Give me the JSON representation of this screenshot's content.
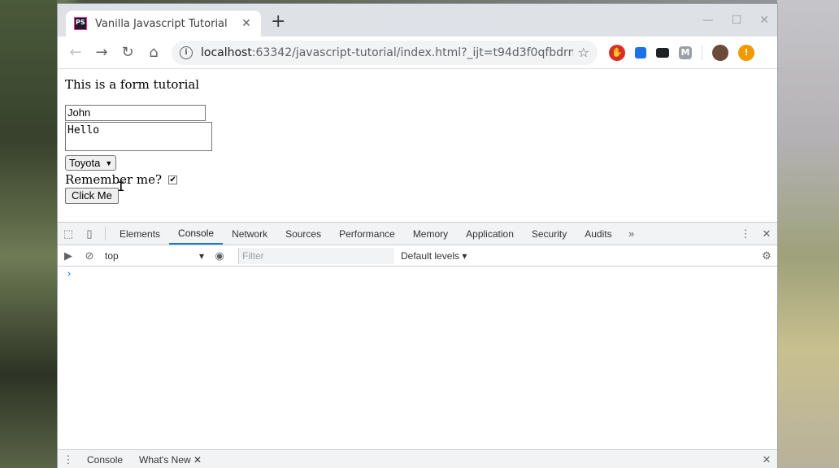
{
  "browser": {
    "tab_title": "Vanilla Javascript Tutorial",
    "favicon_text": "PS",
    "url_host": "localhost",
    "url_rest": ":63342/javascript-tutorial/index.html?_ijt=t94d3f0qfbdrm..."
  },
  "page": {
    "heading": "This is a form tutorial",
    "name_value": "John",
    "message_value": "Hello",
    "car_selected": "Toyota",
    "remember_label": "Remember me?",
    "remember_checked": "✔",
    "button_label": "Click Me"
  },
  "devtools": {
    "tabs": [
      "Elements",
      "Console",
      "Network",
      "Sources",
      "Performance",
      "Memory",
      "Application",
      "Security",
      "Audits"
    ],
    "active_tab": "Console",
    "context": "top",
    "filter_placeholder": "Filter",
    "levels": "Default levels",
    "prompt": "›",
    "drawer_tabs": [
      "Console",
      "What's New"
    ]
  }
}
